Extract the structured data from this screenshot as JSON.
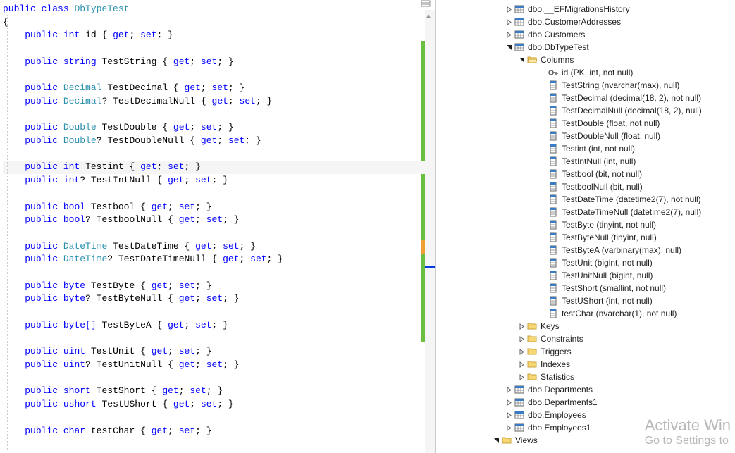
{
  "code": {
    "declaration": {
      "kw1": "public",
      "kw2": "class",
      "name": "DbTypeTest"
    },
    "open_brace": "{",
    "close_brace": "}",
    "props": [
      {
        "mods": "public",
        "type": "int",
        "name": "id",
        "getset": "{ get; set; }",
        "nullable": false,
        "indent": 1,
        "blank_after": true
      },
      {
        "mods": "public",
        "type": "string",
        "name": "TestString",
        "getset": "{ get; set; }",
        "nullable": false,
        "indent": 1,
        "blank_after": true
      },
      {
        "mods": "public",
        "type": "Decimal",
        "name": "TestDecimal",
        "getset": "{ get; set; }",
        "nullable": false,
        "indent": 1,
        "blank_after": false,
        "typeclass": "cl"
      },
      {
        "mods": "public",
        "type": "Decimal",
        "name": "TestDecimalNull",
        "getset": "{ get; set; }",
        "nullable": true,
        "indent": 1,
        "blank_after": true,
        "typeclass": "cl"
      },
      {
        "mods": "public",
        "type": "Double",
        "name": "TestDouble",
        "getset": "{ get; set; }",
        "nullable": false,
        "indent": 1,
        "blank_after": false,
        "typeclass": "cl"
      },
      {
        "mods": "public",
        "type": "Double",
        "name": "TestDoubleNull",
        "getset": "{ get; set; }",
        "nullable": true,
        "indent": 1,
        "blank_after": true,
        "typeclass": "cl"
      },
      {
        "mods": "public",
        "type": "int",
        "name": "Testint",
        "getset": "{ get; set; }",
        "nullable": false,
        "indent": 1,
        "blank_after": false,
        "highlight": true
      },
      {
        "mods": "public",
        "type": "int",
        "name": "TestIntNull",
        "getset": "{ get; set; }",
        "nullable": true,
        "indent": 1,
        "blank_after": true
      },
      {
        "mods": "public",
        "type": "bool",
        "name": "Testbool",
        "getset": "{ get; set; }",
        "nullable": false,
        "indent": 1,
        "blank_after": false
      },
      {
        "mods": "public",
        "type": "bool",
        "name": "TestboolNull",
        "getset": "{ get; set; }",
        "nullable": true,
        "indent": 1,
        "blank_after": true
      },
      {
        "mods": "public",
        "type": "DateTime",
        "name": "TestDateTime",
        "getset": "{ get; set; }",
        "nullable": false,
        "indent": 1,
        "blank_after": false,
        "typeclass": "cl"
      },
      {
        "mods": "public",
        "type": "DateTime",
        "name": "TestDateTimeNull",
        "getset": "{ get; set; }",
        "nullable": true,
        "indent": 1,
        "blank_after": true,
        "typeclass": "cl"
      },
      {
        "mods": "public",
        "type": "byte",
        "name": "TestByte",
        "getset": "{ get; set; }",
        "nullable": false,
        "indent": 1,
        "blank_after": false
      },
      {
        "mods": "public",
        "type": "byte",
        "name": "TestByteNull",
        "getset": "{ get; set; }",
        "nullable": true,
        "indent": 1,
        "blank_after": true
      },
      {
        "mods": "public",
        "type": "byte[]",
        "name": "TestByteA",
        "getset": "{ get; set; }",
        "nullable": false,
        "indent": 1,
        "blank_after": true
      },
      {
        "mods": "public",
        "type": "uint",
        "name": "TestUnit",
        "getset": "{ get; set; }",
        "nullable": false,
        "indent": 1,
        "blank_after": false
      },
      {
        "mods": "public",
        "type": "uint",
        "name": "TestUnitNull",
        "getset": "{ get; set; }",
        "nullable": true,
        "indent": 1,
        "blank_after": true
      },
      {
        "mods": "public",
        "type": "short",
        "name": "TestShort",
        "getset": "{ get; set; }",
        "nullable": false,
        "indent": 1,
        "blank_after": false
      },
      {
        "mods": "public",
        "type": "ushort",
        "name": "TestUShort",
        "getset": "{ get; set; }",
        "nullable": false,
        "indent": 1,
        "blank_after": true
      },
      {
        "mods": "public",
        "type": "char",
        "name": "testChar",
        "getset": "{ get; set; }",
        "nullable": false,
        "indent": 1,
        "blank_after": false
      }
    ]
  },
  "explorer": {
    "tables": [
      {
        "name": "dbo.__EFMigrationsHistory",
        "expanded": false
      },
      {
        "name": "dbo.CustomerAddresses",
        "expanded": false
      },
      {
        "name": "dbo.Customers",
        "expanded": false
      },
      {
        "name": "dbo.DbTypeTest",
        "expanded": true
      }
    ],
    "columns_label": "Columns",
    "columns": [
      {
        "label": "id (PK, int, not null)",
        "pk": true
      },
      {
        "label": "TestString (nvarchar(max), null)"
      },
      {
        "label": "TestDecimal (decimal(18, 2), not null)"
      },
      {
        "label": "TestDecimalNull (decimal(18, 2), null)"
      },
      {
        "label": "TestDouble (float, not null)"
      },
      {
        "label": "TestDoubleNull (float, null)"
      },
      {
        "label": "Testint (int, not null)"
      },
      {
        "label": "TestIntNull (int, null)"
      },
      {
        "label": "Testbool (bit, not null)"
      },
      {
        "label": "TestboolNull (bit, null)"
      },
      {
        "label": "TestDateTime (datetime2(7), not null)"
      },
      {
        "label": "TestDateTimeNull (datetime2(7), null)"
      },
      {
        "label": "TestByte (tinyint, not null)"
      },
      {
        "label": "TestByteNull (tinyint, null)"
      },
      {
        "label": "TestByteA (varbinary(max), null)"
      },
      {
        "label": "TestUnit (bigint, not null)"
      },
      {
        "label": "TestUnitNull (bigint, null)"
      },
      {
        "label": "TestShort (smallint, not null)"
      },
      {
        "label": "TestUShort (int, not null)"
      },
      {
        "label": "testChar (nvarchar(1), not null)"
      }
    ],
    "folders": [
      "Keys",
      "Constraints",
      "Triggers",
      "Indexes",
      "Statistics"
    ],
    "tables_after": [
      "dbo.Departments",
      "dbo.Departments1",
      "dbo.Employees",
      "dbo.Employees1"
    ],
    "views_label": "Views"
  },
  "watermark": {
    "line1": "Activate Win",
    "line2": "Go to Settings to"
  }
}
